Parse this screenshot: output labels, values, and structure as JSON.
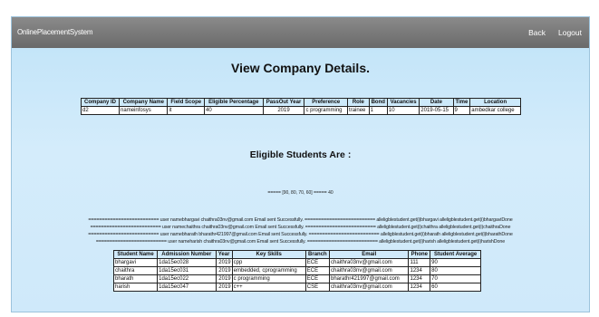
{
  "navbar": {
    "brand": "OnlinePlacementSystem",
    "back": "Back",
    "logout": "Logout"
  },
  "page_title": "View Company Details.",
  "company_table": {
    "headers": [
      "Company ID",
      "Company Name",
      "Field Scope",
      "Eligible Percentage",
      "PassOut Year",
      "Preference",
      "Role",
      "Bond",
      "Vacancies",
      "Date",
      "Time",
      "Location"
    ],
    "row": [
      "d2",
      "nameinfosys",
      "it",
      "40",
      "2019",
      "c programming",
      "trainee",
      "1",
      "10",
      "2019-05-15",
      "9",
      "ambedkar college"
    ]
  },
  "eligible_title": "Eligible Students Are :",
  "score_line": "===== [90, 80, 70, 60] ===== 40",
  "log_lines": [
    "========================== user namebhargavi chaithra03nv@gmail.com Email sent Successfully. ========================== alleligblestudent.get(i)bhargavi alleligblestudent.get(i)bhargaviDone",
    "========================== user namechaithra chaithra03nv@gmail.com Email sent Successfully. ========================== alleligblestudent.get(i)chaithra alleligblestudent.get(i)chaithraDone",
    "========================== user namebharath bharathr421997@gmail.com Email sent Successfully. ========================== alleligblestudent.get(i)bharath alleligblestudent.get(i)bharathDone",
    "========================== user nameharish chaithra03nv@gmail.com Email sent Successfully. ========================== alleligblestudent.get(i)harish alleligblestudent.get(i)harishDone"
  ],
  "students_table": {
    "headers": [
      "Student Name",
      "Admission Number",
      "Year",
      "Key Skills",
      "Branch",
      "Email",
      "Phone",
      "Student Average"
    ],
    "rows": [
      [
        "bhargavi",
        "1da15ec028",
        "2019",
        "cpp",
        "ECE",
        "chaithra03nv@gmail.com",
        "111",
        "90"
      ],
      [
        "chaithra",
        "1da15ec031",
        "2019",
        "embedded, cprogramming",
        "ECE",
        "chaithra03nv@gmail.com",
        "1234",
        "80"
      ],
      [
        "bharath",
        "1da15ec022",
        "2019",
        "c programming",
        "ECE",
        "bharathr421997@gmail.com",
        "1234",
        "70"
      ],
      [
        "harish",
        "1da15ec047",
        "2019",
        "c++",
        "CSE",
        "chaithra03nv@gmail.com",
        "1234",
        "60"
      ]
    ]
  }
}
